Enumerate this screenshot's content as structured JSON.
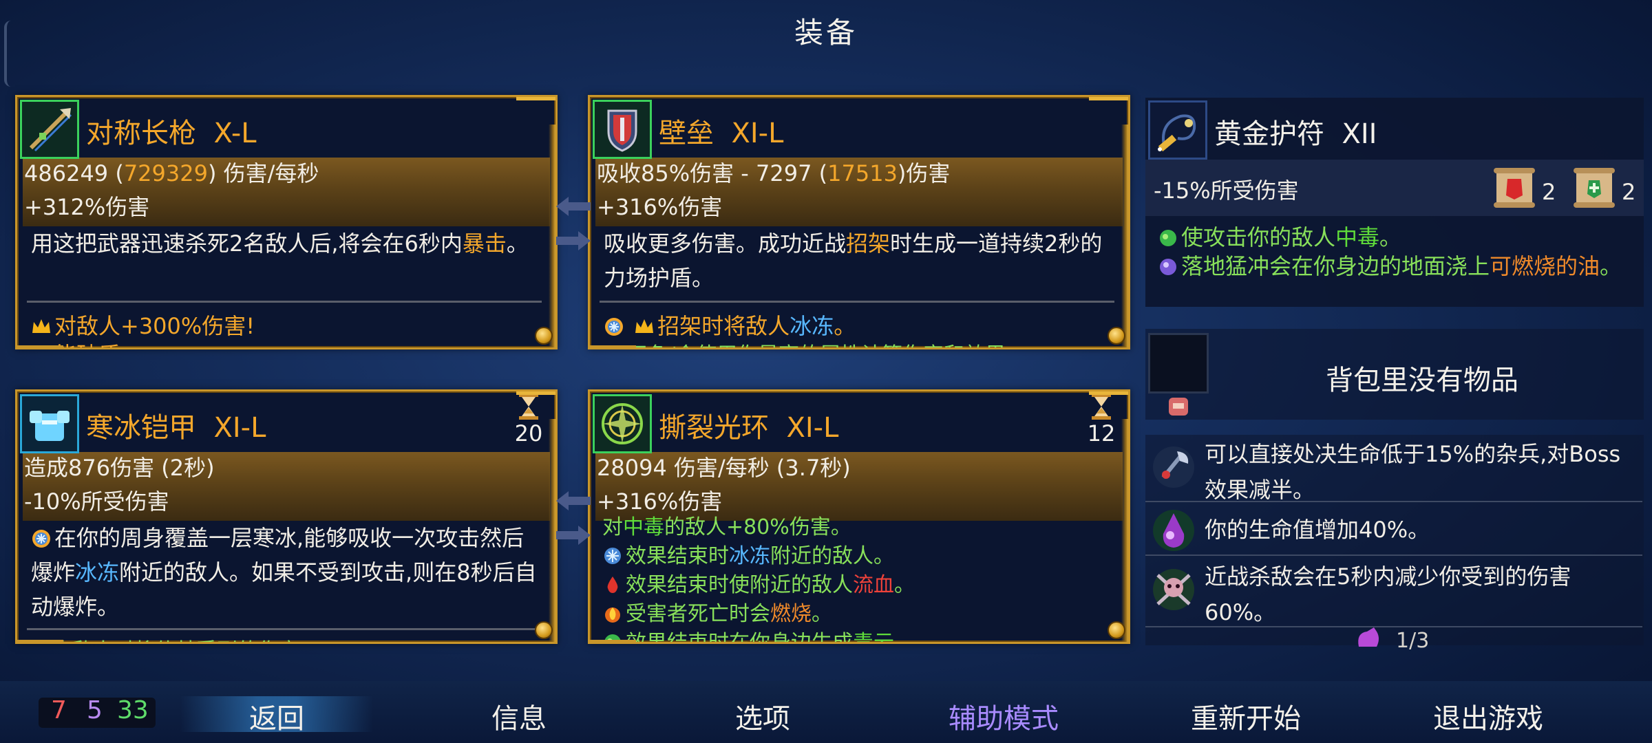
{
  "header": {
    "title": "装备"
  },
  "cards": {
    "weapon1": {
      "name": "对称长枪",
      "tier": "X-L",
      "stat1_base": "486249 (",
      "stat1_hl": "729329",
      "stat1_tail": ") 伤害/每秒",
      "stat2": "+312%伤害",
      "desc_a": "用这把武器迅速杀死2名敌人后,将会在6秒内",
      "desc_hl": "暴击",
      "desc_b": "。",
      "perk1": "对敌人+300%伤害!",
      "perk2": "能破盾"
    },
    "weapon2": {
      "name": "壁垒",
      "tier": "XI-L",
      "stat1_base": "吸收85%伤害 - 7297 (",
      "stat1_hl": "17513",
      "stat1_tail": ")伤害",
      "stat2": "+316%伤害",
      "desc_a": "吸收更多伤害。成功近战",
      "desc_hl": "招架",
      "desc_b": "时生成一道持续2秒的力场护盾。",
      "perk1_a": "招架时将敌人",
      "perk1_hl": "冰冻",
      "perk1_b": "。",
      "perk2": "天色/会使用你最高的属性计算伤害和效果"
    },
    "skill1": {
      "name": "寒冰铠甲",
      "tier": "XI-L",
      "cooldown": "20",
      "stat1": "造成876伤害 (2秒)",
      "stat2": "-10%所受伤害",
      "desc_a": "在你的周身覆盖一层寒冰,能够吸收一次攻击然后爆炸",
      "desc_hl": "冰冻",
      "desc_b": "附近的敌人。如果不受到攻击,则在8秒后自动爆炸。",
      "perk_cut": "冷冻敌人时将使其受到的伤害"
    },
    "skill2": {
      "name": "撕裂光环",
      "tier": "XI-L",
      "cooldown": "12",
      "stat1": "28094 伤害/每秒 (3.7秒)",
      "stat2": "+316%伤害",
      "line0_a": "对",
      "line0_hl": "中毒",
      "line0_b": "的敌人+80%伤害。",
      "line1_a": "效果结束时",
      "line1_hl": "冰冻",
      "line1_b": "附近的敌人。",
      "line2_a": "效果结束时使附近的敌人",
      "line2_hl": "流血",
      "line2_b": "。",
      "line3_a": "受害者死亡时会",
      "line3_hl": "燃烧",
      "line3_b": "。",
      "line4_a": "效果结束时在你身边生成",
      "line4_hl": "毒云",
      "line4_b": "。"
    }
  },
  "amulet": {
    "name": "黄金护符",
    "tier": "XII",
    "stat": "-15%所受伤害",
    "scroll1_count": "2",
    "scroll2_count": "2",
    "line1_a": "使攻击你的敌人",
    "line1_hl": "中毒",
    "line1_b": "。",
    "line2_a": "落地猛冲会在你身边的地面浇上",
    "line2_hl": "可燃烧的油",
    "line2_b": "。"
  },
  "backpack": {
    "empty_text": "背包里没有物品"
  },
  "mutations": [
    {
      "text": "可以直接处决生命低于15%的杂兵,对Boss效果减半。"
    },
    {
      "text": "你的生命值增加40%。"
    },
    {
      "text": "近战杀敌会在5秒内减少你受到的伤害60%。"
    }
  ],
  "potion": {
    "count": "1/3"
  },
  "scrolls": {
    "red": "7",
    "purple": "5",
    "green": "33"
  },
  "menu": {
    "back": "返回",
    "info": "信息",
    "options": "选项",
    "assist": "辅助模式",
    "restart": "重新开始",
    "quit": "退出游戏"
  },
  "colors": {
    "gold_text": "#f4a72b",
    "freeze_blue": "#58b8ff",
    "poison_green": "#88e05a",
    "bleed_red": "#f0423a",
    "burn_orange": "#f08a2a",
    "assist_purple": "#a98bff",
    "card_border": "#c9962a"
  }
}
